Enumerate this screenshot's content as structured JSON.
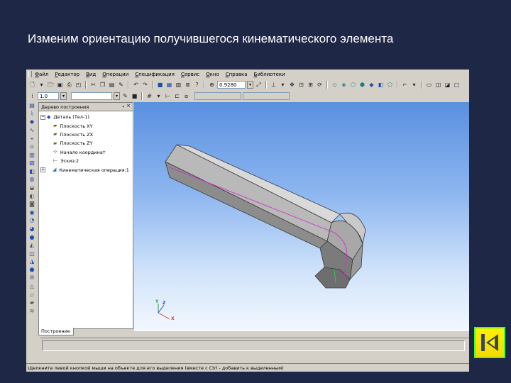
{
  "slide": {
    "title": "Изменим ориентацию получившегося кинематического элемента"
  },
  "app": {
    "menu": [
      "Файл",
      "Редактор",
      "Вид",
      "Операции",
      "Спецификация",
      "Сервис",
      "Окно",
      "Справка",
      "Библиотеки"
    ],
    "toolbar": {
      "zoom_value": "0.9280",
      "step_value": "1.0"
    },
    "tree": {
      "title": "Дерево построения",
      "items": [
        {
          "label": "Деталь (Тел-1)",
          "icon": "part-icon"
        },
        {
          "label": "Плоскость XY",
          "icon": "plane-icon"
        },
        {
          "label": "Плоскость ZX",
          "icon": "plane-icon"
        },
        {
          "label": "Плоскость ZY",
          "icon": "plane-icon"
        },
        {
          "label": "Начало координат",
          "icon": "origin-icon"
        },
        {
          "label": "Эскиз:2",
          "icon": "sketch-icon"
        },
        {
          "label": "Кинематическая операция:1",
          "icon": "kinematic-operation-icon"
        }
      ],
      "tab_label": "Построение"
    },
    "viewport": {
      "axis_x": "X",
      "axis_y": "Y",
      "axis_z": "Z"
    },
    "status_hint": "Щелкните левой кнопкой мыши на объекте для его выделения (вместе с Ctrl - добавить к выделенным)"
  },
  "nav": {
    "back_button_icon": "skip-back-icon"
  },
  "colors": {
    "slide_background": "#1f2747",
    "window_chrome": "#d4d0c8",
    "viewport_top": "#5a90e0",
    "viewport_bottom": "#f3f8ff",
    "nav_button": "#fff200",
    "nav_button_border": "#39ff3d"
  }
}
